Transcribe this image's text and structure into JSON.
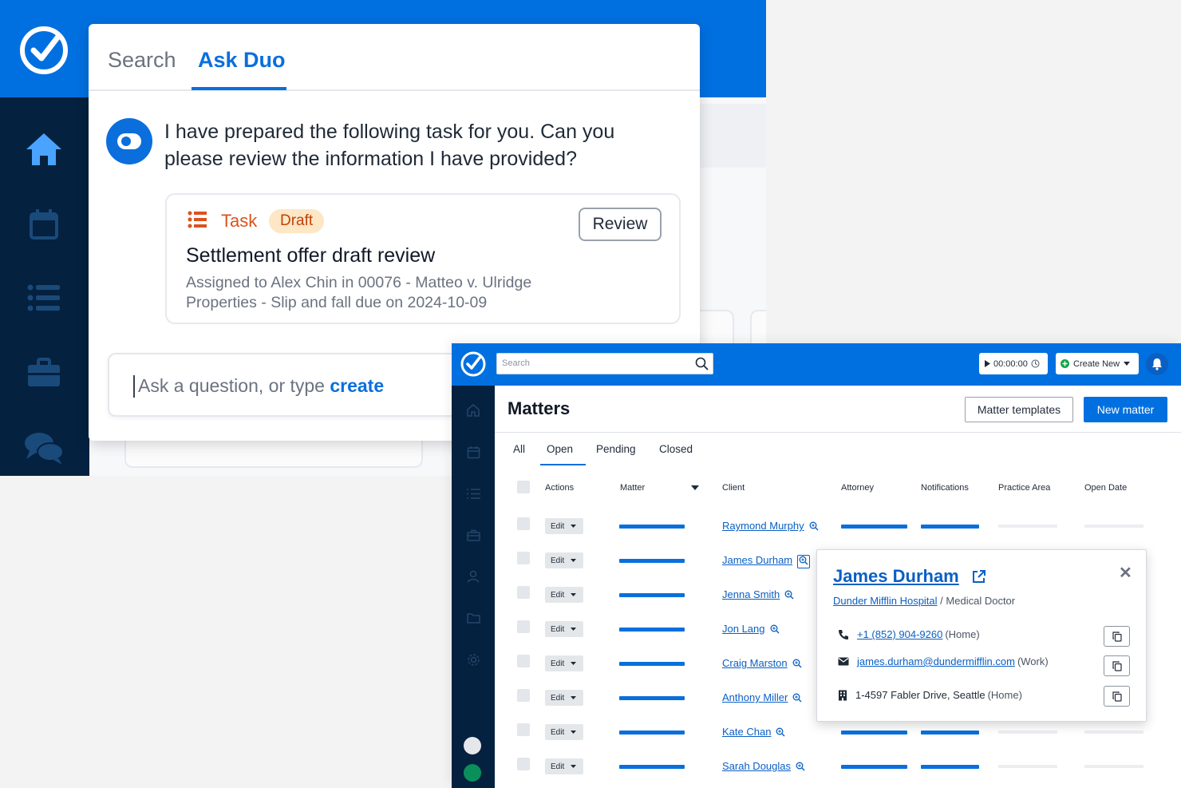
{
  "duo": {
    "tabs": [
      {
        "label": "Search"
      },
      {
        "label": "Ask Duo"
      }
    ],
    "message": "I have prepared the following task for you. Can you please review the information I have provided?",
    "task": {
      "type": "Task",
      "badge": "Draft",
      "review_label": "Review",
      "title": "Settlement offer draft review",
      "description": "Assigned to Alex Chin in 00076 - Matteo v. Ulridge Properties - Slip and fall due on 2024-10-09"
    },
    "input": {
      "placeholder_prefix": "Ask a question, or type ",
      "placeholder_keyword": "create"
    }
  },
  "matters_app": {
    "search_placeholder": "Search",
    "timer": "00:00:00",
    "create_new": "Create New",
    "page_title": "Matters",
    "matter_templates_label": "Matter templates",
    "new_matter_label": "New matter",
    "tabs": [
      "All",
      "Open",
      "Pending",
      "Closed"
    ],
    "active_tab": "Open",
    "columns": [
      "Actions",
      "Matter",
      "Client",
      "Attorney",
      "Notifications",
      "Practice Area",
      "Open Date"
    ],
    "edit_label": "Edit",
    "rows": [
      {
        "client": "Raymond Murphy"
      },
      {
        "client": "James Durham"
      },
      {
        "client": "Jenna Smith"
      },
      {
        "client": "Jon Lang"
      },
      {
        "client": "Craig Marston"
      },
      {
        "client": "Anthony Miller"
      },
      {
        "client": "Kate Chan"
      },
      {
        "client": "Sarah Douglas"
      }
    ]
  },
  "contact_popup": {
    "name": "James Durham",
    "company": "Dunder Mifflin Hospital",
    "separator": "/",
    "role": "Medical Doctor",
    "phone": "+1 (852) 904-9260",
    "phone_type": "(Home)",
    "email": "james.durham@dundermifflin.com",
    "email_type": "(Work)",
    "address": "1-4597 Fabler Drive, Seattle",
    "address_type": "(Home)"
  },
  "colors": {
    "brand_blue": "#0070e0",
    "sidebar_navy": "#04213f",
    "link_blue": "#0a5fc4",
    "task_orange": "#d9531e",
    "draft_badge_bg": "#fde7c4"
  }
}
